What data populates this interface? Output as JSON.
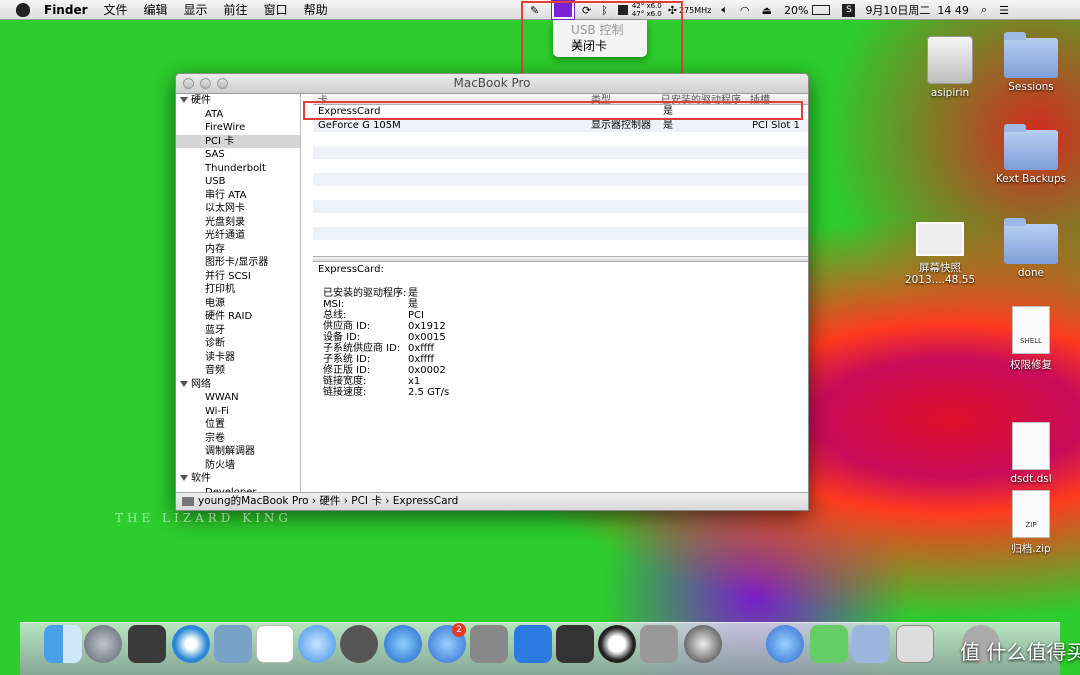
{
  "menubar": {
    "app": "Finder",
    "items": [
      "文件",
      "编辑",
      "显示",
      "前往",
      "窗口",
      "帮助"
    ],
    "freq": "275MHz",
    "battery": "20%",
    "datetime": "9月10日周二  14 49",
    "temps": [
      "42° x6.0",
      "47° x6.0"
    ]
  },
  "usb_menu": {
    "header": "USB 控制器",
    "item": "关闭卡"
  },
  "window": {
    "title": "MacBook Pro",
    "sidebar": [
      {
        "type": "cat",
        "label": "硬件"
      },
      {
        "type": "item",
        "label": "ATA"
      },
      {
        "type": "item",
        "label": "FireWire"
      },
      {
        "type": "item",
        "label": "PCI 卡",
        "selected": true
      },
      {
        "type": "item",
        "label": "SAS"
      },
      {
        "type": "item",
        "label": "Thunderbolt"
      },
      {
        "type": "item",
        "label": "USB"
      },
      {
        "type": "item",
        "label": "串行 ATA"
      },
      {
        "type": "item",
        "label": "以太网卡"
      },
      {
        "type": "item",
        "label": "光盘刻录"
      },
      {
        "type": "item",
        "label": "光纤通道"
      },
      {
        "type": "item",
        "label": "内存"
      },
      {
        "type": "item",
        "label": "图形卡/显示器"
      },
      {
        "type": "item",
        "label": "并行 SCSI"
      },
      {
        "type": "item",
        "label": "打印机"
      },
      {
        "type": "item",
        "label": "电源"
      },
      {
        "type": "item",
        "label": "硬件 RAID"
      },
      {
        "type": "item",
        "label": "蓝牙"
      },
      {
        "type": "item",
        "label": "诊断"
      },
      {
        "type": "item",
        "label": "读卡器"
      },
      {
        "type": "item",
        "label": "音频"
      },
      {
        "type": "cat",
        "label": "网络"
      },
      {
        "type": "item",
        "label": "WWAN"
      },
      {
        "type": "item",
        "label": "Wi-Fi"
      },
      {
        "type": "item",
        "label": "位置"
      },
      {
        "type": "item",
        "label": "宗卷"
      },
      {
        "type": "item",
        "label": "调制解调器"
      },
      {
        "type": "item",
        "label": "防火墙"
      },
      {
        "type": "cat",
        "label": "软件"
      },
      {
        "type": "item",
        "label": "Developer"
      }
    ],
    "table": {
      "columns": [
        "卡",
        "类型",
        "已安装的驱动程序",
        "插槽"
      ],
      "rows": [
        [
          "ExpressCard",
          "",
          "是",
          ""
        ],
        [
          "GeForce G 105M",
          "显示器控制器",
          "是",
          "PCI Slot 1"
        ]
      ]
    },
    "detail": {
      "title": "ExpressCard:",
      "fields": [
        [
          "已安装的驱动程序:",
          "是"
        ],
        [
          "MSI:",
          "是"
        ],
        [
          "总线:",
          "PCI"
        ],
        [
          "供应商 ID:",
          "0x1912"
        ],
        [
          "设备 ID:",
          "0x0015"
        ],
        [
          "子系统供应商 ID:",
          "0xffff"
        ],
        [
          "子系统 ID:",
          "0xffff"
        ],
        [
          "修正版 ID:",
          "0x0002"
        ],
        [
          "链接宽度:",
          "x1"
        ],
        [
          "链接速度:",
          "2.5 GT/s"
        ]
      ]
    },
    "path": [
      "young的MacBook Pro",
      "硬件",
      "PCI 卡",
      "ExpressCard"
    ]
  },
  "desktop": [
    {
      "label": "asipirin",
      "kind": "drive"
    },
    {
      "label": "Sessions",
      "kind": "folder"
    },
    {
      "label": "Kext Backups",
      "kind": "folder"
    },
    {
      "label": "屏幕快照\n2013....48.55",
      "kind": "shot"
    },
    {
      "label": "done",
      "kind": "folder"
    },
    {
      "label": "权限修复",
      "kind": "doc",
      "badge": "SHELL"
    },
    {
      "label": "dsdt.dsl",
      "kind": "doc",
      "badge": ""
    },
    {
      "label": "归档.zip",
      "kind": "doc",
      "badge": "ZIP"
    }
  ],
  "watermark": "THE LIZARD KING",
  "dock_badge": "2",
  "brand": "值 什么值得买"
}
